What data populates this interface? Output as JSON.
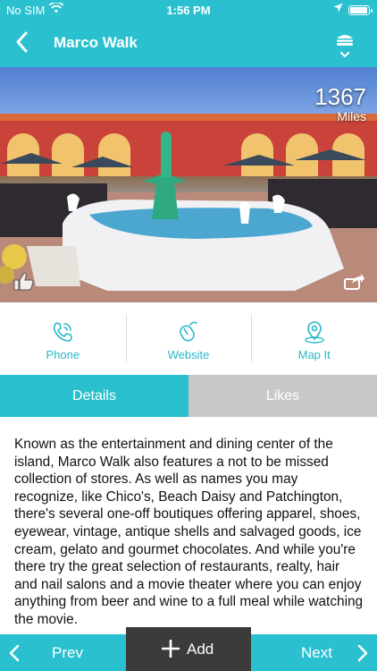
{
  "status_bar": {
    "carrier": "No SIM",
    "time": "1:56 PM"
  },
  "nav": {
    "title": "Marco Walk"
  },
  "hero": {
    "distance_value": "1367",
    "distance_unit": "Miles"
  },
  "actions": [
    {
      "label": "Phone",
      "icon": "phone-icon"
    },
    {
      "label": "Website",
      "icon": "mouse-icon"
    },
    {
      "label": "Map It",
      "icon": "map-pin-icon"
    }
  ],
  "tabs": [
    {
      "label": "Details",
      "active": true
    },
    {
      "label": "Likes",
      "active": false
    }
  ],
  "details": {
    "text": "Known as the entertainment and dining center of the island, Marco Walk also features a not to be missed collection of stores. As well as names you may recognize, like Chico's, Beach Daisy and Patchington, there's several one-off boutiques offering apparel, shoes, eyewear, vintage, antique shells and salvaged goods, ice cream, gelato and gourmet chocolates. And while you're there try the great selection of restaurants, realty, hair and nail salons and a movie theater where you can enjoy anything from beer and wine to a full meal while watching the movie."
  },
  "bottom": {
    "prev_label": "Prev",
    "next_label": "Next",
    "add_label": "Add"
  },
  "colors": {
    "accent": "#2ac0cf",
    "inactive_tab": "#c8c8c8",
    "add_button": "#3b3b3b"
  }
}
